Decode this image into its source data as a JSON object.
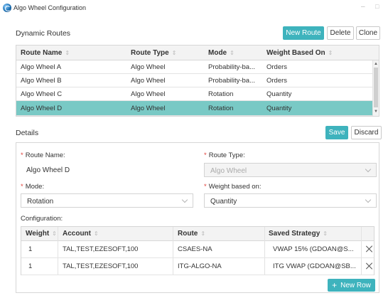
{
  "window": {
    "title": "Algo Wheel Configuration",
    "minimize": "–",
    "maximize": "□"
  },
  "routes": {
    "title": "Dynamic Routes",
    "buttons": {
      "new_route": "New Route",
      "delete": "Delete",
      "clone": "Clone"
    },
    "columns": [
      "Route Name",
      "Route Type",
      "Mode",
      "Weight Based On"
    ],
    "rows": [
      [
        "Algo Wheel A",
        "Algo Wheel",
        "Probability-ba...",
        "Orders"
      ],
      [
        "Algo Wheel B",
        "Algo Wheel",
        "Probability-ba...",
        "Orders"
      ],
      [
        "Algo Wheel C",
        "Algo Wheel",
        "Rotation",
        "Quantity"
      ],
      [
        "Algo Wheel D",
        "Algo Wheel",
        "Rotation",
        "Quantity"
      ]
    ],
    "selected_index": 3
  },
  "details": {
    "title": "Details",
    "buttons": {
      "save": "Save",
      "discard": "Discard"
    },
    "required_mark": "*",
    "route_name": {
      "label": "Route Name",
      "value": "Algo Wheel D"
    },
    "route_type": {
      "label": "Route Type",
      "value": "Algo Wheel"
    },
    "mode": {
      "label": "Mode",
      "value": "Rotation"
    },
    "weight_based_on": {
      "label": "Weight based on",
      "value": "Quantity"
    },
    "configuration": {
      "label": "Configuration",
      "columns": [
        "Weight",
        "Account",
        "Route",
        "Saved Strategy"
      ],
      "rows": [
        [
          "1",
          "TAL,TEST,EZESOFT,100",
          "CSAES-NA",
          "VWAP 15% (GDOAN@S..."
        ],
        [
          "1",
          "TAL,TEST,EZESOFT,100",
          "ITG-ALGO-NA",
          "ITG VWAP (GDOAN@SB..."
        ]
      ],
      "new_row_label": "New Row"
    }
  },
  "colors": {
    "accent": "#3eb3bd",
    "selected_row": "#79c9c5",
    "required": "#e0413a"
  }
}
